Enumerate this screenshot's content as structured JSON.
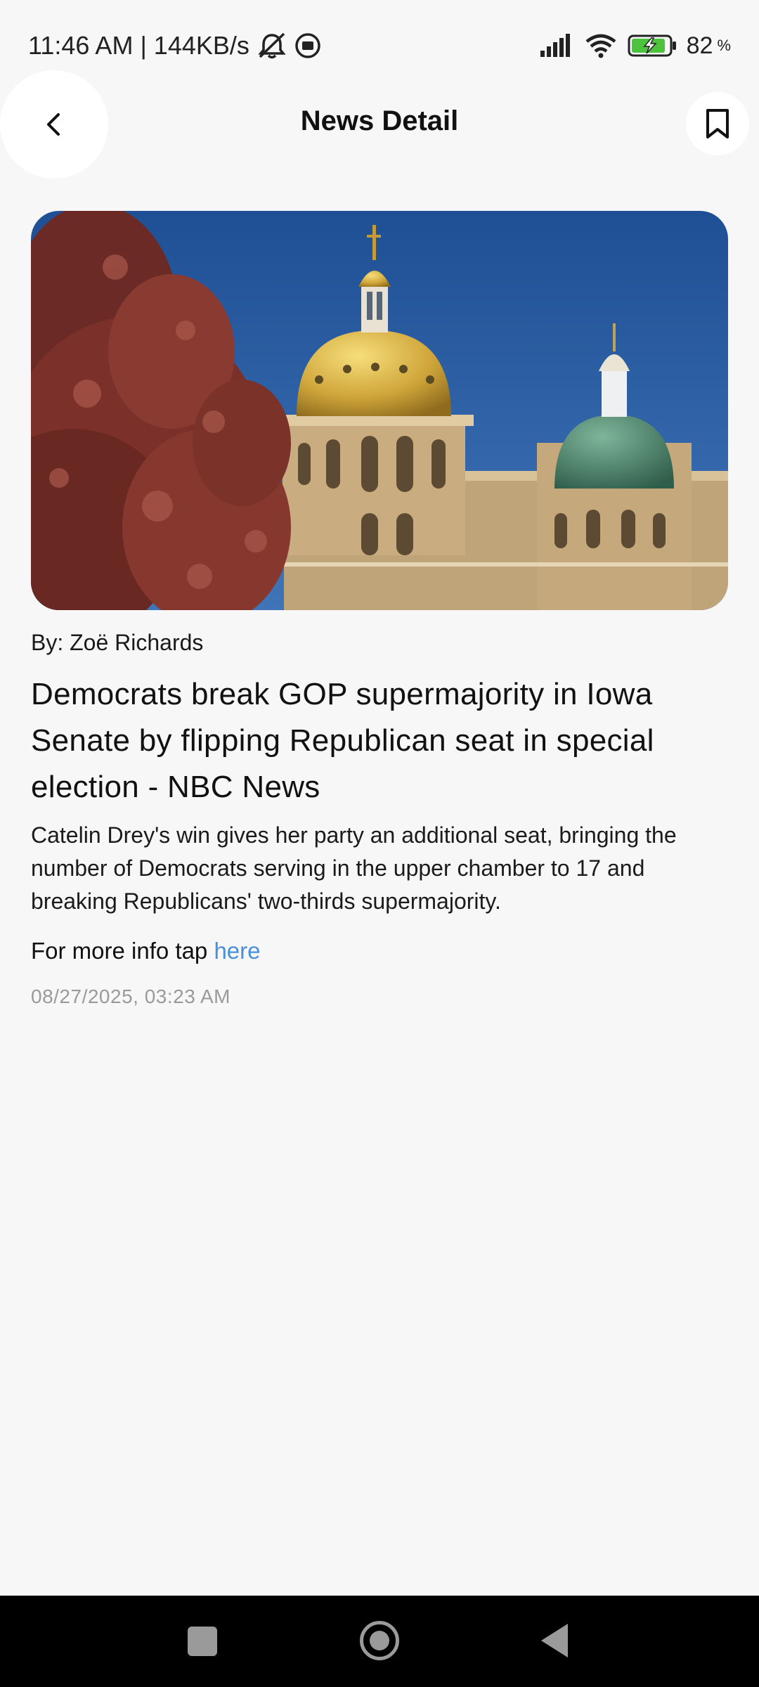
{
  "status_bar": {
    "time": "11:46 AM",
    "separator": "|",
    "speed": "144KB/s",
    "battery_percent": "82",
    "battery_suffix": "%",
    "icons": [
      "mute-bell-icon",
      "record-icon",
      "signal-icon",
      "wifi-icon",
      "battery-charging-icon"
    ]
  },
  "app_bar": {
    "title": "News Detail",
    "back_icon": "chevron-left-icon",
    "bookmark_icon": "bookmark-icon"
  },
  "article": {
    "author": "By: Zoë Richards",
    "headline": "Democrats break GOP supermajority in Iowa Senate by flipping Republican seat in special election - NBC News",
    "summary": "Catelin Drey's win gives her party an additional seat, bringing the number of Democrats serving in the upper chamber to 17 and breaking Republicans' two-thirds supermajority.",
    "more_info_prefix": "For more info tap ",
    "more_info_link": "here",
    "timestamp": "08/27/2025, 03:23 AM"
  },
  "nav_bar": {
    "buttons": [
      "recent-apps-button",
      "home-button",
      "back-button"
    ]
  },
  "colors": {
    "background": "#f7f7f7",
    "link": "#4a90d9",
    "timestamp": "#9a9a9a",
    "nav_background": "#000000"
  }
}
